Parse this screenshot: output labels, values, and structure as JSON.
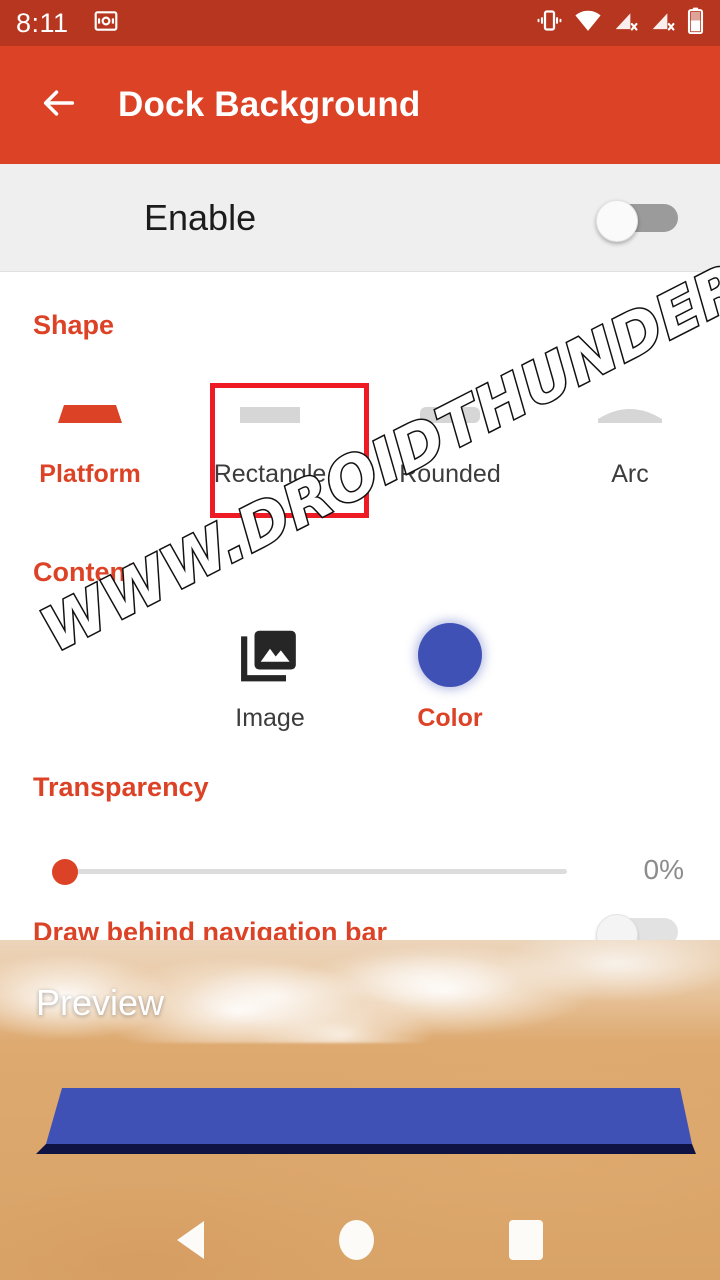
{
  "status_bar": {
    "time": "8:11",
    "icons_left": [
      "screenshot-icon"
    ],
    "icons_right": [
      "vibrate-icon",
      "wifi-icon",
      "signal-no-sim-1-icon",
      "signal-no-sim-2-icon",
      "battery-icon"
    ],
    "background_color": "#b7361f"
  },
  "app_bar": {
    "back_icon": "back-arrow-icon",
    "title": "Dock Background",
    "background_color": "#dc4326"
  },
  "enable": {
    "label": "Enable",
    "toggle_state": "off"
  },
  "shape": {
    "section_title": "Shape",
    "selected": "Platform",
    "options": [
      {
        "label": "Platform",
        "glyph": "trapezoid-shape-icon",
        "selected": true
      },
      {
        "label": "Rectangle",
        "glyph": "rectangle-shape-icon",
        "selected": false
      },
      {
        "label": "Rounded",
        "glyph": "rounded-rect-shape-icon",
        "selected": false
      },
      {
        "label": "Arc",
        "glyph": "arc-shape-icon",
        "selected": false
      }
    ]
  },
  "content": {
    "section_title": "Content",
    "selected": "Color",
    "options": [
      {
        "label": "Image",
        "glyph": "image-icon",
        "selected": false
      },
      {
        "label": "Color",
        "glyph": "color-swatch-icon",
        "selected": true,
        "swatch_color": "#3f51b5"
      }
    ]
  },
  "transparency": {
    "section_title": "Transparency",
    "value_label": "0%",
    "value": 0,
    "min": 0,
    "max": 100
  },
  "draw_behind_nav": {
    "label": "Draw behind navigation bar",
    "toggle_state": "off"
  },
  "preview": {
    "label": "Preview",
    "dock_shape": "platform-trapezoid",
    "dock_color": "#3f51b5",
    "dock_edge_color": "#0f1344",
    "nav_buttons": [
      "back-triangle-icon",
      "home-circle-icon",
      "recents-square-icon"
    ]
  },
  "annotation": {
    "target": "Rectangle",
    "box_color": "#ee1b24"
  },
  "watermark": {
    "text": "WWW.DROIDTHUNDER.COM"
  },
  "colors": {
    "accent": "#dc4326",
    "status_bar": "#b7361f",
    "section_bg": "#efefef",
    "annotation": "#ee1b24"
  }
}
